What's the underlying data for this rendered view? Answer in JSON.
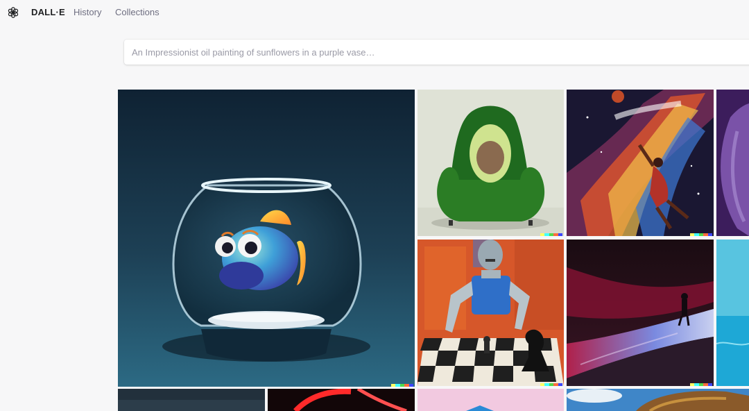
{
  "header": {
    "logo_icon": "openai-logo-icon",
    "brand": "DALL·E",
    "nav": [
      {
        "label": "History"
      },
      {
        "label": "Collections"
      }
    ]
  },
  "search": {
    "value": "",
    "placeholder": "An Impressionist oil painting of sunflowers in a purple vase…"
  },
  "gallery": {
    "items": [
      {
        "subject": "fish-in-bowl",
        "image_icon": "fish-bowl-image"
      },
      {
        "subject": "avocado-armchair",
        "image_icon": "avocado-chair-image"
      },
      {
        "subject": "space-basketball-painting",
        "image_icon": "cosmic-dunk-image"
      },
      {
        "subject": "purple-creature-cropped",
        "image_icon": "purple-fur-image"
      },
      {
        "subject": "robot-playing-chess-painting",
        "image_icon": "robot-chess-image"
      },
      {
        "subject": "figure-on-dune",
        "image_icon": "dune-figure-image"
      },
      {
        "subject": "ocean-cropped",
        "image_icon": "ocean-image"
      },
      {
        "subject": "dark-scene-cropped",
        "image_icon": "dark-image"
      },
      {
        "subject": "neon-red-cropped",
        "image_icon": "neon-image"
      },
      {
        "subject": "pink-scene-cropped",
        "image_icon": "pink-image"
      },
      {
        "subject": "sky-food-cropped",
        "image_icon": "sky-image"
      }
    ],
    "signature_colors": [
      "#ffff66",
      "#42ffff",
      "#51da4c",
      "#ff6e3c",
      "#3c46ff"
    ]
  }
}
